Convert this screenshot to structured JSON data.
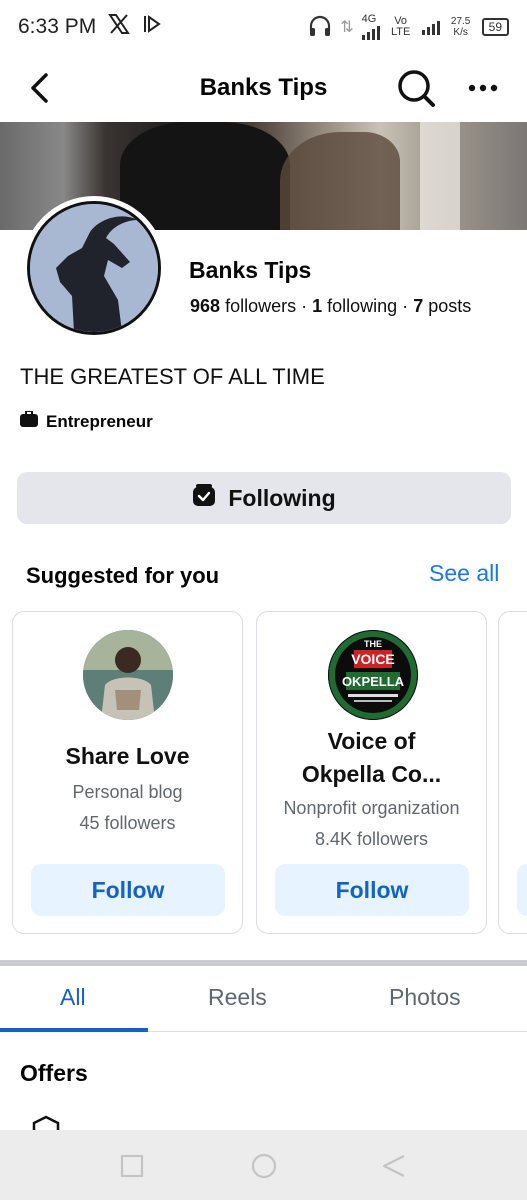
{
  "status_bar": {
    "time": "6:33 PM",
    "network_4g": "4G",
    "network_volte": "Vo LTE",
    "speed": "27.5 K/s",
    "battery": "59"
  },
  "header": {
    "title": "Banks Tips"
  },
  "profile": {
    "name": "Banks Tips",
    "followers_count": "968",
    "followers_label": "followers ·",
    "following_count": "1",
    "following_label": "following ·",
    "posts_count": "7",
    "posts_label": "posts",
    "bio": "THE GREATEST OF ALL TIME",
    "category": "Entrepreneur",
    "following_button_label": "Following"
  },
  "suggested": {
    "title": "Suggested for you",
    "see_all": "See all",
    "cards": [
      {
        "name": "Share Love",
        "type": "Personal blog",
        "followers": "45 followers",
        "follow_label": "Follow"
      },
      {
        "name_line1": "Voice of",
        "name_line2": "Okpella Co...",
        "type": "Nonprofit organization",
        "followers": "8.4K followers",
        "follow_label": "Follow",
        "logo_line1": "THE",
        "logo_line2": "VOICE",
        "logo_line3": "OKPELLA"
      }
    ]
  },
  "tabs": [
    {
      "label": "All",
      "active": true
    },
    {
      "label": "Reels",
      "active": false
    },
    {
      "label": "Photos",
      "active": false
    }
  ],
  "offers": {
    "title": "Offers"
  },
  "colors": {
    "accent": "#1877f2",
    "follow_text": "#1461c7",
    "follow_bg": "#e7f3ff",
    "button_gray": "#e4e6eb"
  },
  "icons": [
    "x-logo-icon",
    "media-icon",
    "headphones-icon",
    "back-icon",
    "search-icon",
    "more-icon",
    "briefcase-icon",
    "following-icon",
    "nav-square-icon",
    "nav-home-icon",
    "nav-back-icon"
  ]
}
